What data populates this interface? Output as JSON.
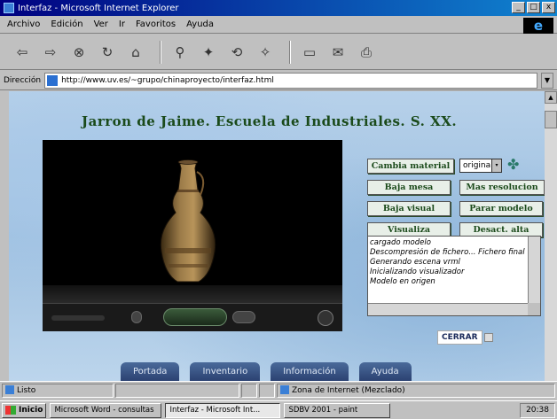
{
  "window": {
    "title": "Interfaz - Microsoft Internet Explorer",
    "min_glyph": "_",
    "max_glyph": "□",
    "close_glyph": "x"
  },
  "menu": [
    "Archivo",
    "Edición",
    "Ver",
    "Ir",
    "Favoritos",
    "Ayuda"
  ],
  "toolbar_icons": [
    "back-icon",
    "forward-icon",
    "stop-icon",
    "refresh-icon",
    "home-icon",
    "search-icon",
    "favorites-icon",
    "history-icon",
    "channels-icon",
    "fullscreen-icon",
    "mail-icon",
    "print-icon"
  ],
  "toolbar_glyphs": {
    "back": "⇦",
    "forward": "⇨",
    "stop": "⊗",
    "refresh": "↻",
    "home": "⌂",
    "search": "⚲",
    "favorites": "✦",
    "history": "⟲",
    "channels": "✧",
    "fullscreen": "▭",
    "mail": "✉",
    "print": "⎙"
  },
  "address": {
    "label": "Dirección",
    "url": "http://www.uv.es/~grupo/chinaproyecto/interfaz.html",
    "drop_glyph": "▼"
  },
  "page": {
    "title": "Jarron de Jaime. Escuela de Industriales. S. XX."
  },
  "controls": {
    "cambia_material": "Cambia material",
    "select_value": "original",
    "select_glyph": "▾",
    "brazo_icon_glyph": "✤",
    "baja_mesa": "Baja mesa",
    "mas_resolucion": "Mas resolucion",
    "baja_visual": "Baja visual",
    "parar_modelo": "Parar modelo",
    "visualiza": "Visualiza",
    "desactiva": "Desact. alta"
  },
  "log": {
    "lines": [
      "cargado modelo",
      "Descompresión de fichero... Fichero final",
      "Generando escena vrml",
      "Inicializando visualizador",
      "Modelo en origen"
    ]
  },
  "close_button": "CERRAR",
  "nav_tabs": [
    "Portada",
    "Inventario",
    "Información",
    "Ayuda"
  ],
  "status": {
    "left": "Listo",
    "zone": "Zona de Internet (Mezclado)"
  },
  "taskbar": {
    "start": "Inicio",
    "tasks": [
      "Microsoft Word - consultas",
      "Interfaz - Microsoft Int...",
      "SDBV 2001 - paint"
    ],
    "time": "20:38"
  },
  "colors": {
    "titlebar": "#000080",
    "button_text": "#1b4a1b",
    "page_title": "#1a4a1a",
    "nav_tab": "#2a4070"
  }
}
